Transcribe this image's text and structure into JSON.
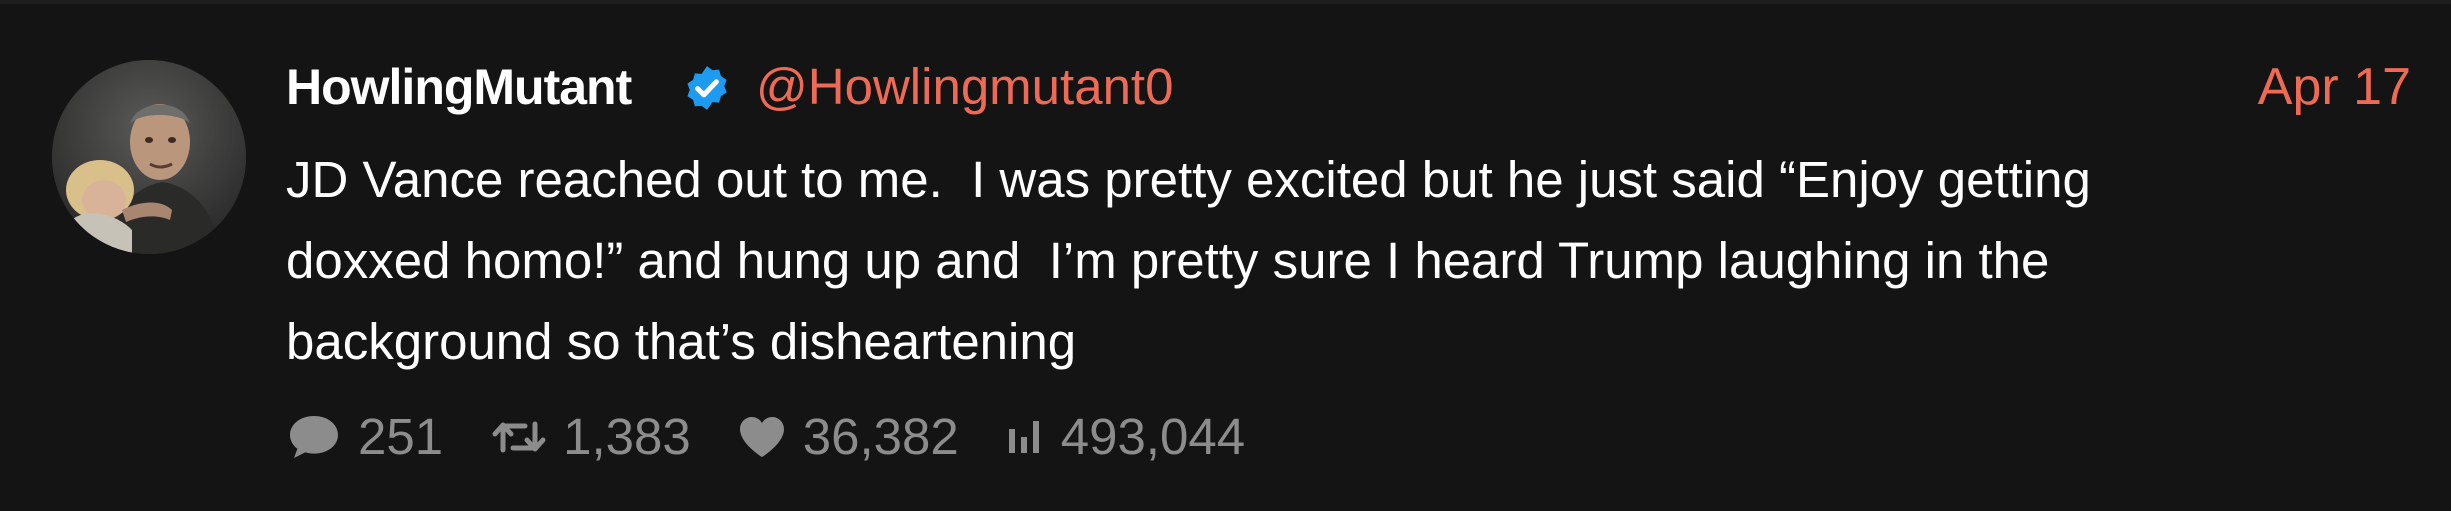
{
  "tweet": {
    "author": {
      "display_name": "HowlingMutant",
      "handle": "@Howlingmutant0",
      "verified": true
    },
    "date": "Apr 17",
    "text_lines": [
      "JD Vance reached out to me.  I was pretty excited but he just said “Enjoy getting",
      "doxxed homo!” and hung up and  I’m pretty sure I heard Trump laughing in the",
      "background so that’s disheartening"
    ],
    "stats": {
      "replies": "251",
      "retweets": "1,383",
      "likes": "36,382",
      "views": "493,044"
    }
  },
  "icons": {
    "verified": "verified-badge-icon",
    "reply": "speech-bubble-icon",
    "retweet": "retweet-arrows-icon",
    "like": "heart-icon",
    "views": "bar-chart-icon"
  },
  "colors": {
    "background": "#141414",
    "text": "#ffffff",
    "accent": "#ef6a55",
    "muted": "#8c8c8c",
    "verified": "#1d9bf0"
  }
}
